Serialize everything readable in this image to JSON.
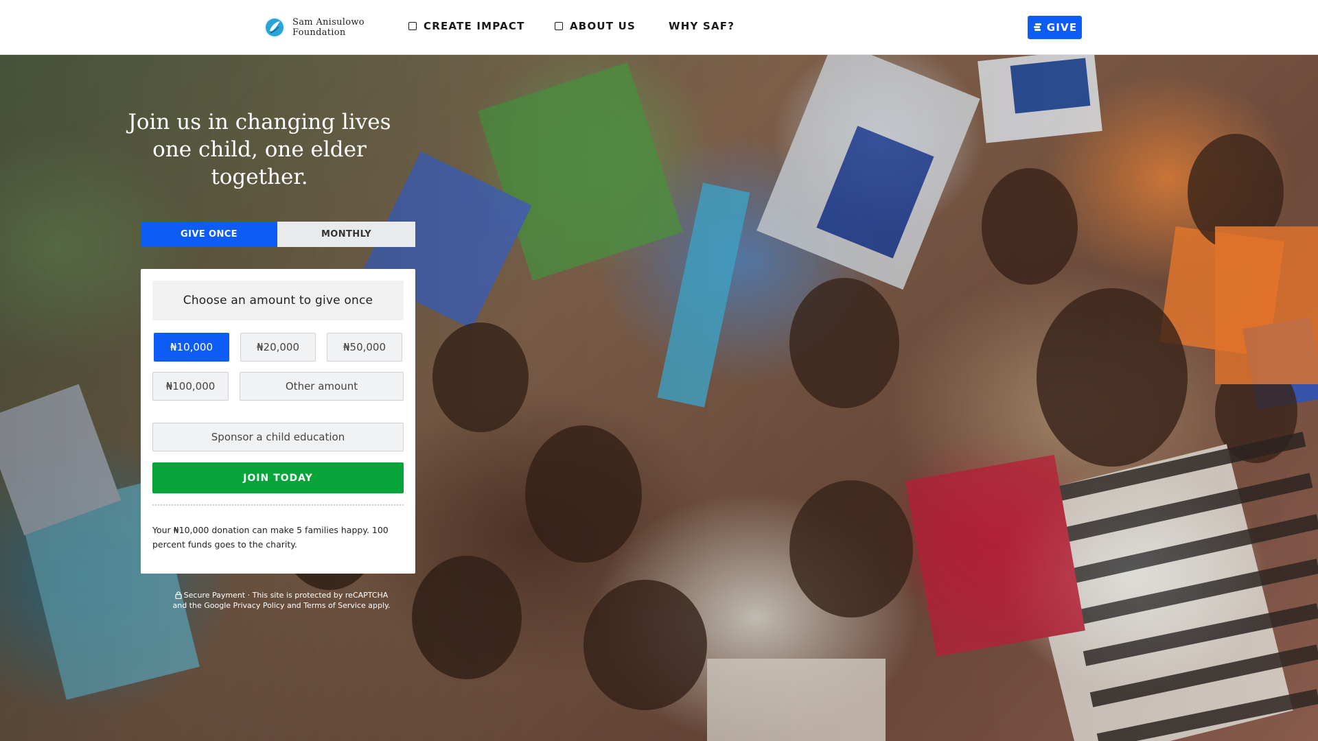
{
  "nav": {
    "brand_line1": "Sam Anisulowo",
    "brand_line2": "Foundation",
    "items": [
      {
        "label": "CREATE IMPACT"
      },
      {
        "label": "ABOUT US"
      },
      {
        "label": "WHY SAF?"
      }
    ],
    "give_label": "GIVE",
    "give_icon": "coins-icon"
  },
  "hero": {
    "title_line1": "Join us in changing lives",
    "title_line2": "one child, one elder",
    "title_line3": "together.",
    "image": "children-holding-books-photo"
  },
  "tabs": {
    "once": "GIVE ONCE",
    "monthly": "MONTHLY",
    "selected": "once"
  },
  "form": {
    "heading": "Choose an amount to give once",
    "amounts": [
      "₦10,000",
      "₦20,000",
      "₦50,000",
      "₦100,000"
    ],
    "selected_amount": "₦10,000",
    "other_amount": "Other amount",
    "purpose": "Sponsor a child education",
    "submit": "JOIN TODAY",
    "note": "Your ₦10,000 donation can make 5 families happy. 100 percent funds goes to the charity."
  },
  "secure": {
    "line1": "Secure Payment · This site is protected by reCAPTCHA",
    "line2": "and the Google Privacy Policy and Terms of Service apply."
  },
  "colors": {
    "primary": "#0d5cf5",
    "success": "#07a43a",
    "text": "#1a1a1a"
  }
}
